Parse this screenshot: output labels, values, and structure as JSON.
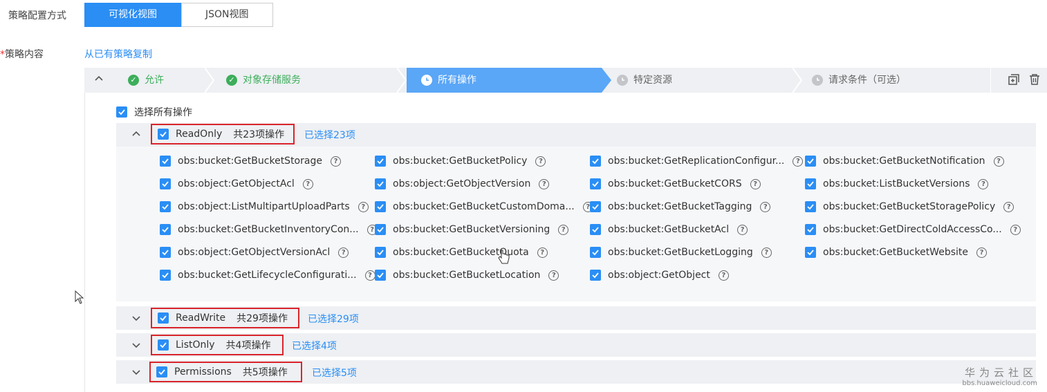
{
  "config_mode": {
    "label": "策略配置方式",
    "tabs": [
      {
        "label": "可视化视图",
        "active": true
      },
      {
        "label": "JSON视图",
        "active": false
      }
    ]
  },
  "policy_content": {
    "required_mark": "*",
    "label": "策略内容",
    "copy_link": "从已有策略复制"
  },
  "steps": [
    {
      "label": "允许",
      "state": "done"
    },
    {
      "label": "对象存储服务",
      "state": "done"
    },
    {
      "label": "所有操作",
      "state": "active"
    },
    {
      "label": "特定资源",
      "state": "pending"
    },
    {
      "label": "请求条件（可选）",
      "state": "pending"
    }
  ],
  "select_all_label": "选择所有操作",
  "groups": [
    {
      "name": "ReadOnly",
      "count": "共23项操作",
      "selected": "已选择23项",
      "expanded": true
    },
    {
      "name": "ReadWrite",
      "count": "共29项操作",
      "selected": "已选择29项",
      "expanded": false
    },
    {
      "name": "ListOnly",
      "count": "共4项操作",
      "selected": "已选择4项",
      "expanded": false
    },
    {
      "name": "Permissions",
      "count": "共5项操作",
      "selected": "已选择5项",
      "expanded": false
    }
  ],
  "readonly_ops": [
    [
      "obs:bucket:GetBucketStorage",
      "obs:bucket:GetBucketPolicy",
      "obs:bucket:GetReplicationConfigur...",
      "obs:bucket:GetBucketNotification"
    ],
    [
      "obs:object:GetObjectAcl",
      "obs:object:GetObjectVersion",
      "obs:bucket:GetBucketCORS",
      "obs:bucket:ListBucketVersions"
    ],
    [
      "obs:object:ListMultipartUploadParts",
      "obs:bucket:GetBucketCustomDoma...",
      "obs:bucket:GetBucketTagging",
      "obs:bucket:GetBucketStoragePolicy"
    ],
    [
      "obs:bucket:GetBucketInventoryCon...",
      "obs:bucket:GetBucketVersioning",
      "obs:bucket:GetBucketAcl",
      "obs:bucket:GetDirectColdAccessCo..."
    ],
    [
      "obs:object:GetObjectVersionAcl",
      "obs:bucket:GetBucketQuota",
      "obs:bucket:GetBucketLogging",
      "obs:bucket:GetBucketWebsite"
    ],
    [
      "obs:bucket:GetLifecycleConfigurati...",
      "obs:bucket:GetBucketLocation",
      "obs:object:GetObject",
      ""
    ]
  ],
  "watermark": {
    "title": "华为云社区",
    "url": "bbs.huaweicloud.com"
  },
  "colors": {
    "primary": "#2a8ef5",
    "done": "#3dae5b",
    "highlight_border": "#d9242b",
    "active_step": "#5aa6f7"
  }
}
